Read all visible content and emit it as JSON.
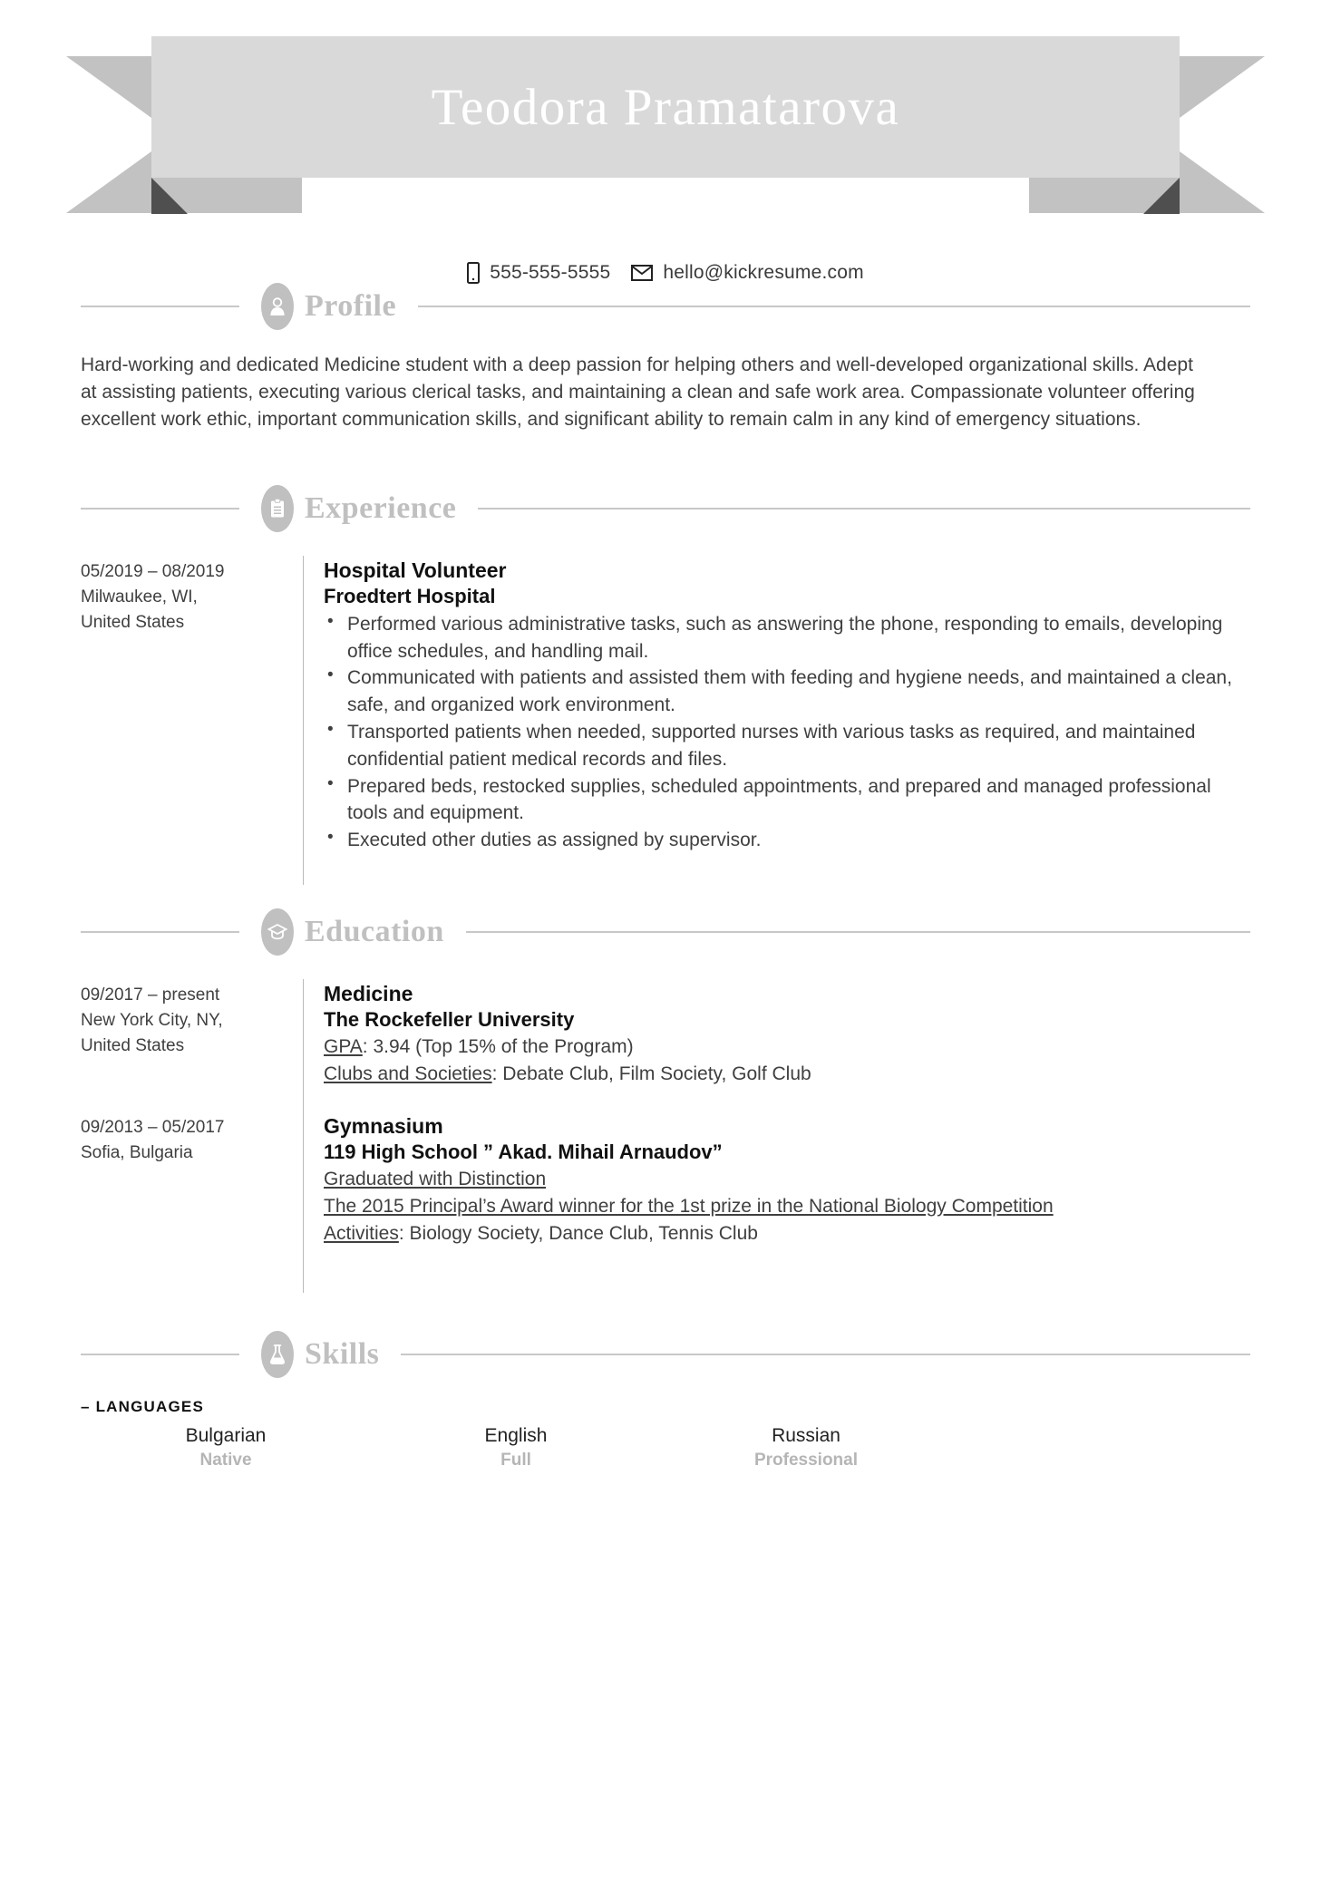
{
  "header": {
    "name": "Teodora Pramatarova",
    "contacts": [
      {
        "icon": "phone-icon",
        "value": "555-555-5555"
      },
      {
        "icon": "envelope-icon",
        "value": "hello@kickresume.com"
      }
    ]
  },
  "colors": {
    "ribbon_center": "#d9d9d9",
    "ribbon_wing": "#c2c2c2",
    "ribbon_fold": "#4f4f4f",
    "section_accent": "#c0c0c0",
    "rule": "#c8c8c8",
    "body_text": "#3f3f3f",
    "muted_text": "#b5b5b5"
  },
  "sections": {
    "profile": {
      "title": "Profile",
      "icon": "person-icon",
      "text": "Hard-working and dedicated Medicine student with a deep passion for helping others and well-developed organizational skills. Adept at assisting patients, executing various clerical tasks, and maintaining a clean and safe work area. Compassionate volunteer offering excellent work ethic, important communication skills, and significant ability to remain calm in any kind of emergency situations."
    },
    "experience": {
      "title": "Experience",
      "icon": "clipboard-icon",
      "entries": [
        {
          "dates": "05/2019 – 08/2019",
          "location_line1": "Milwaukee, WI,",
          "location_line2": "United States",
          "title": "Hospital Volunteer",
          "organization": "Froedtert Hospital",
          "bullets": [
            "Performed various administrative tasks, such as answering the phone, responding to emails, developing office schedules, and handling mail.",
            "Communicated with patients and assisted them with feeding and hygiene needs, and maintained a clean, safe, and organized work environment.",
            "Transported patients when needed, supported nurses with various tasks as required, and maintained confidential patient medical records and files.",
            "Prepared beds, restocked supplies, scheduled appointments, and prepared and managed professional tools and equipment.",
            "Executed other duties as assigned by supervisor."
          ]
        }
      ]
    },
    "education": {
      "title": "Education",
      "icon": "graduation-cap-icon",
      "entries": [
        {
          "dates": "09/2017 – present",
          "location_line1": "New York City, NY,",
          "location_line2": "United States",
          "title": "Medicine",
          "organization": "The Rockefeller University",
          "details": [
            {
              "label": "GPA",
              "separator": ": ",
              "value": "3.94 (Top 15% of the Program)",
              "underline_all": false
            },
            {
              "label": "Clubs and Societies",
              "separator": ": ",
              "value": "Debate Club, Film Society, Golf Club",
              "underline_all": false
            }
          ]
        },
        {
          "dates": "09/2013 – 05/2017",
          "location_line1": "Sofia, Bulgaria",
          "location_line2": "",
          "title": "Gymnasium",
          "organization": "119 High School ” Akad. Mihail Arnaudov”",
          "details": [
            {
              "label": "Graduated with Distinction",
              "separator": "",
              "value": "",
              "underline_all": true
            },
            {
              "label": "The 2015 Principal’s Award winner for the 1st prize in the National Biology Competition",
              "separator": "",
              "value": "",
              "underline_all": true
            },
            {
              "label": "Activities",
              "separator": ": ",
              "value": "Biology Society, Dance Club, Tennis Club",
              "underline_all": false
            }
          ]
        }
      ]
    },
    "skills": {
      "title": "Skills",
      "icon": "flask-icon",
      "languages_label": "– LANGUAGES",
      "languages": [
        {
          "name": "Bulgarian",
          "level": "Native"
        },
        {
          "name": "English",
          "level": "Full"
        },
        {
          "name": "Russian",
          "level": "Professional"
        }
      ]
    }
  }
}
